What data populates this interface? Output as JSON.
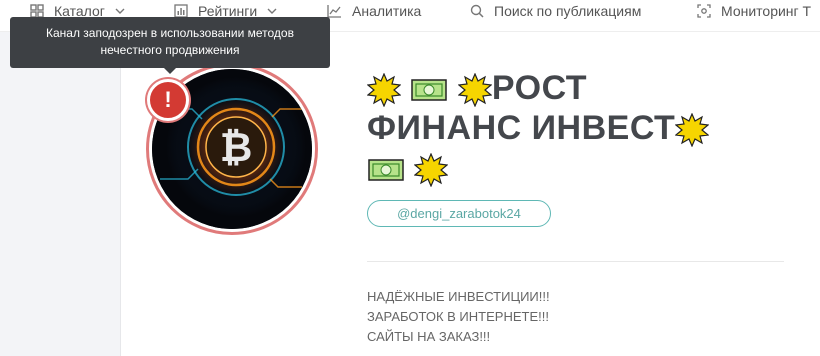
{
  "nav": {
    "catalog": "Каталог",
    "ratings": "Рейтинги",
    "analytics": "Аналитика",
    "search": "Поиск по публикациям",
    "monitoring": "Мониторинг Т"
  },
  "tooltip": {
    "text_line1": "Канал заподозрен в использовании методов",
    "text_line2": "нечестного продвижения"
  },
  "warning_badge": {
    "symbol": "!"
  },
  "channel": {
    "title_line1": "РОСТ",
    "title_line2": "ФИНАНС ИНВЕСТ",
    "handle": "@dengi_zarabotok24",
    "description": [
      "НАДЁЖНЫЕ ИНВЕСТИЦИИ!!!",
      "ЗАРАБОТОК В ИНТЕРНЕТЕ!!!",
      "САЙТЫ НА ЗАКАЗ!!!"
    ]
  },
  "avatar": {
    "symbol": "₿"
  },
  "icons": [
    "grid-icon",
    "chevron-down-icon",
    "bar-chart-icon",
    "trend-icon",
    "search-icon",
    "scan-icon",
    "starburst-icon",
    "dollar-bill-icon"
  ],
  "colors": {
    "accent_teal": "#5fb8b5",
    "warning_red": "#d33a33",
    "ring_red": "#e07a7a",
    "tooltip_bg": "#3d4044",
    "bitcoin_orange": "#f7931a"
  }
}
